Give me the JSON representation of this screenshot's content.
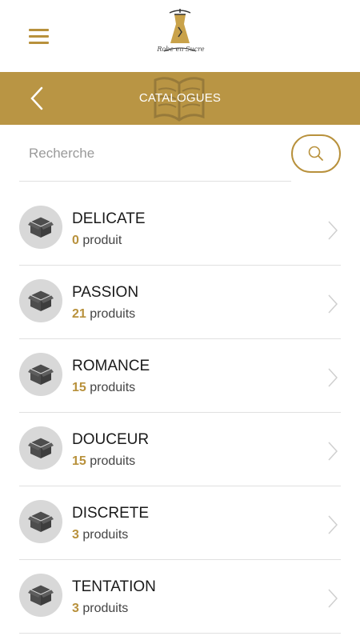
{
  "header": {
    "menu_icon": "hamburger-icon",
    "logo_text": "Robe en Sucre"
  },
  "titlebar": {
    "title": "CATALOGUES",
    "back_icon": "chevron-left-icon",
    "background_icon": "open-book-icon"
  },
  "search": {
    "placeholder": "Recherche",
    "value": "",
    "icon": "search-icon"
  },
  "catalogues": [
    {
      "name": "DELICATE",
      "count": "0",
      "unit": "produit"
    },
    {
      "name": "PASSION",
      "count": "21",
      "unit": "produits"
    },
    {
      "name": "ROMANCE",
      "count": "15",
      "unit": "produits"
    },
    {
      "name": "DOUCEUR",
      "count": "15",
      "unit": "produits"
    },
    {
      "name": "DISCRETE",
      "count": "3",
      "unit": "produits"
    },
    {
      "name": "TENTATION",
      "count": "3",
      "unit": "produits"
    }
  ],
  "colors": {
    "accent": "#b8913c",
    "titlebar": "#b99544",
    "avatar_bg": "#d8d8d8"
  }
}
